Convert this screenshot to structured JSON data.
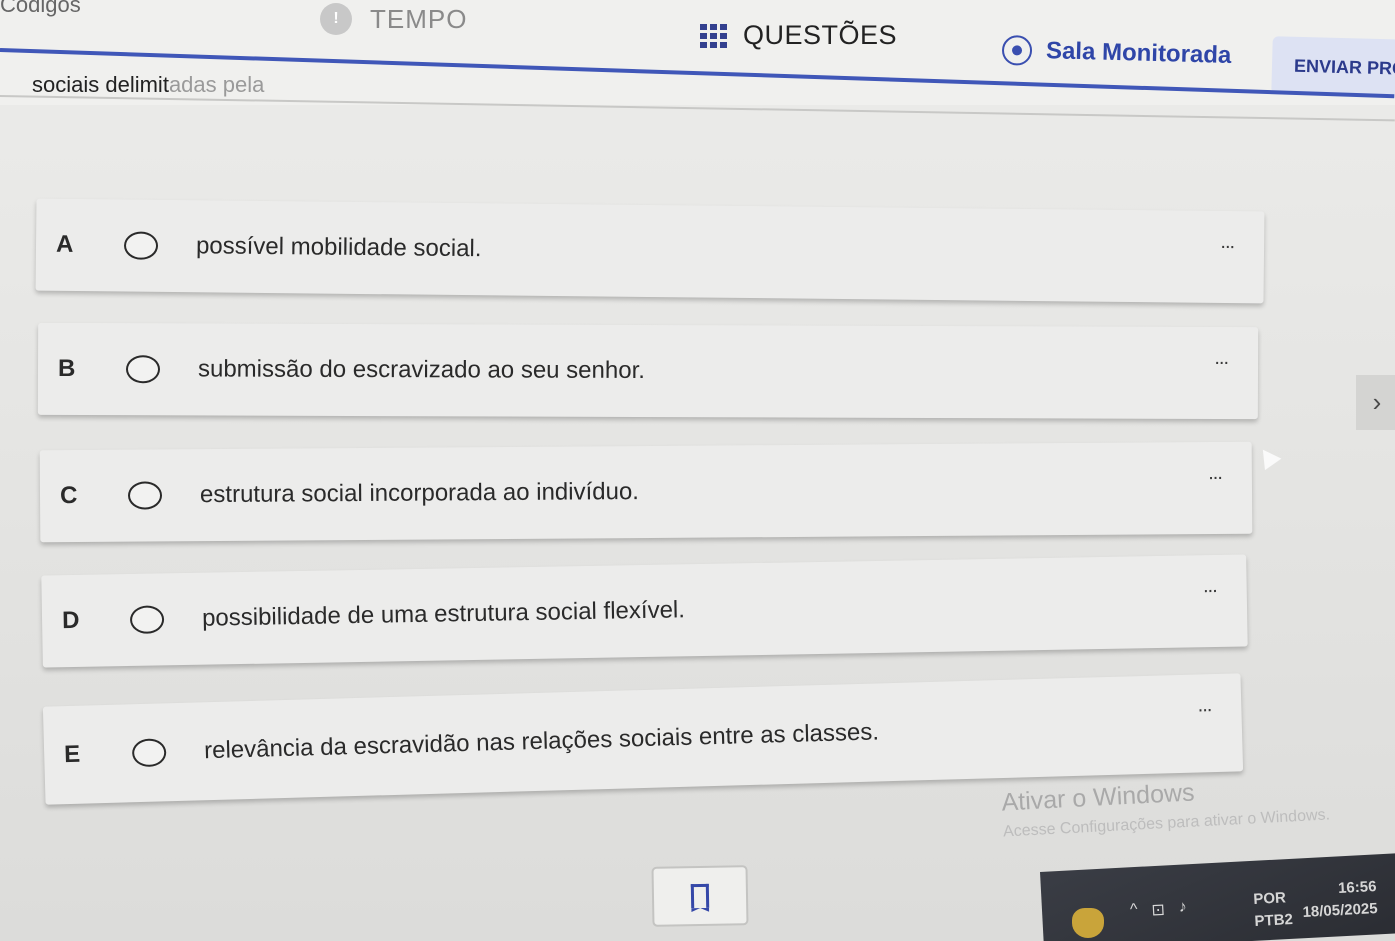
{
  "header": {
    "top_cut_text": "Códigos",
    "timer_label": "TEMPO",
    "questions_label": "QUESTÕES",
    "room_label": "Sala Monitorada",
    "submit_label": "ENVIAR PRO"
  },
  "question": {
    "text_visible": "sociais delimit",
    "text_faded": "adas pela"
  },
  "options": [
    {
      "letter": "A",
      "text": "possível mobilidade social.",
      "more": "..."
    },
    {
      "letter": "B",
      "text": "submissão do escravizado ao seu senhor.",
      "more": "..."
    },
    {
      "letter": "C",
      "text": "estrutura social incorporada ao indivíduo.",
      "more": "..."
    },
    {
      "letter": "D",
      "text": "possibilidade de uma estrutura social flexível.",
      "more": "..."
    },
    {
      "letter": "E",
      "text": "relevância da escravidão nas relações sociais entre as classes.",
      "more": "..."
    }
  ],
  "navigation": {
    "next_icon": "›"
  },
  "watermark": {
    "title": "Ativar o Windows",
    "subtitle": "Acesse Configurações para ativar o Windows."
  },
  "taskbar": {
    "lang_top": "POR",
    "lang_bottom": "PTB2",
    "time": "16:56",
    "date": "18/05/2025"
  },
  "colors": {
    "accent": "#3a4fb0",
    "card": "#ececeb",
    "background": "#e4e4e2"
  }
}
